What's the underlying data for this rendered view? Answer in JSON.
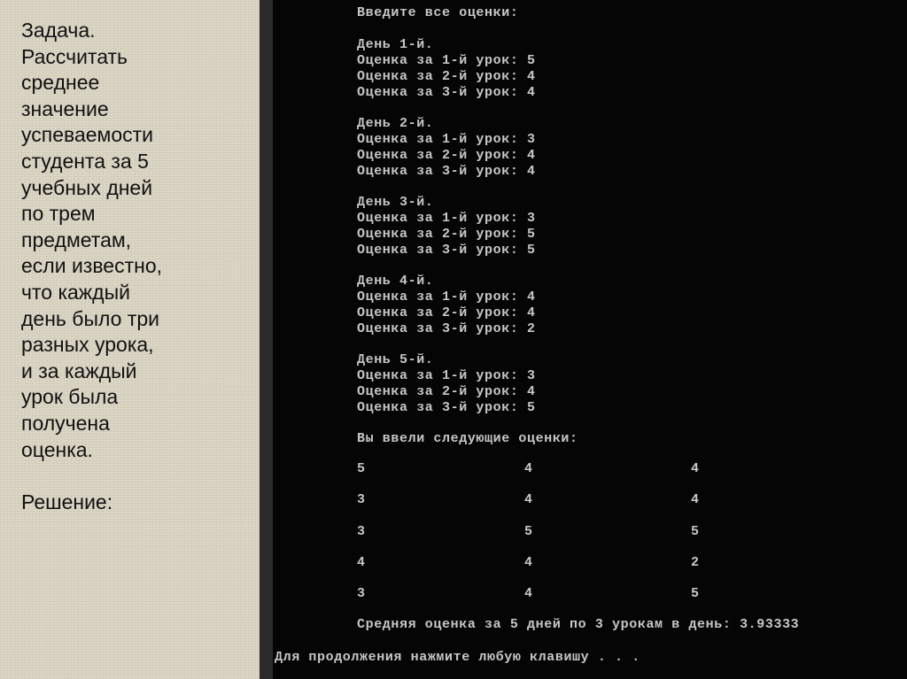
{
  "slide": {
    "lines": [
      "Задача.",
      "Рассчитать",
      "среднее",
      "значение",
      "успеваемости",
      "студента за 5",
      "учебных дней",
      "по трем",
      "предметам,",
      "если известно,",
      "что каждый",
      "день было три",
      "разных урока,",
      "и за каждый",
      "урок была",
      "получена",
      "оценка."
    ],
    "solution_label": "Решение:"
  },
  "console": {
    "prompt": "Введите все оценки:",
    "days": [
      {
        "header": "День 1-й.",
        "lines": [
          "Оценка за 1-й урок: 5",
          "Оценка за 2-й урок: 4",
          "Оценка за 3-й урок: 4"
        ]
      },
      {
        "header": "День 2-й.",
        "lines": [
          "Оценка за 1-й урок: 3",
          "Оценка за 2-й урок: 4",
          "Оценка за 3-й урок: 4"
        ]
      },
      {
        "header": "День 3-й.",
        "lines": [
          "Оценка за 1-й урок: 3",
          "Оценка за 2-й урок: 5",
          "Оценка за 3-й урок: 5"
        ]
      },
      {
        "header": "День 4-й.",
        "lines": [
          "Оценка за 1-й урок: 4",
          "Оценка за 2-й урок: 4",
          "Оценка за 3-й урок: 2"
        ]
      },
      {
        "header": "День 5-й.",
        "lines": [
          "Оценка за 1-й урок: 3",
          "Оценка за 2-й урок: 4",
          "Оценка за 3-й урок: 5"
        ]
      }
    ],
    "entered_label": "Вы ввели следующие оценки:",
    "grid": [
      [
        "5",
        "4",
        "4"
      ],
      [
        "3",
        "4",
        "4"
      ],
      [
        "3",
        "5",
        "5"
      ],
      [
        "4",
        "4",
        "2"
      ],
      [
        "3",
        "4",
        "5"
      ]
    ],
    "average_line": "Средняя оценка за 5 дней по 3 урокам в день: 3.93333",
    "continue_line": "Для продолжения нажмите любую клавишу . . ."
  }
}
